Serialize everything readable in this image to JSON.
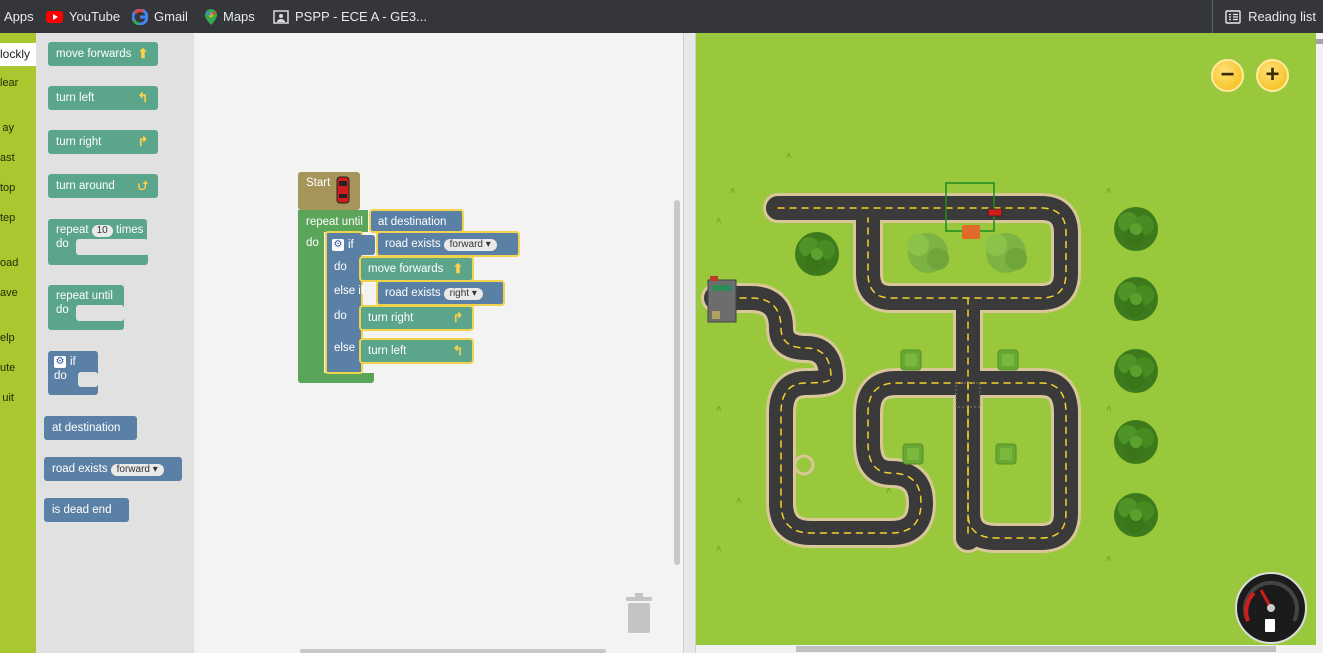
{
  "bookmarks": {
    "items": [
      {
        "label": "Apps",
        "icon": "apps-icon"
      },
      {
        "label": "YouTube",
        "icon": "youtube-icon"
      },
      {
        "label": "Gmail",
        "icon": "google-icon"
      },
      {
        "label": "Maps",
        "icon": "maps-icon"
      },
      {
        "label": "PSPP - ECE A - GE3...",
        "icon": "classroom-icon"
      }
    ],
    "reading_list": "Reading list"
  },
  "sidebar": {
    "active_tab": "lockly",
    "items": [
      "lear",
      "ay",
      "ast",
      "top",
      "tep",
      "oad",
      "ave",
      "elp",
      "ute",
      "uit"
    ]
  },
  "toolbox": {
    "move_forwards": "move forwards",
    "turn_left": "turn left",
    "turn_right": "turn right",
    "turn_around": "turn around",
    "repeat_label": "repeat",
    "repeat_count": "10",
    "times_label": "times",
    "do_label": "do",
    "repeat_until": "repeat until",
    "if_label": "if",
    "at_destination": "at destination",
    "road_exists": "road exists",
    "road_exists_option": "forward",
    "is_dead_end": "is dead end"
  },
  "program": {
    "start": "Start",
    "repeat_until": "repeat until",
    "condition": "at destination",
    "do_label": "do",
    "if_label": "if",
    "if_condition": "road exists",
    "if_option": "forward",
    "if_action": "move forwards",
    "else_if_label": "else if",
    "else_if_condition": "road exists",
    "else_if_option": "right",
    "else_if_action": "turn right",
    "else_label": "else",
    "else_action": "turn left"
  },
  "map": {
    "zoom_out": "−",
    "zoom_in": "+",
    "colors": {
      "grass": "#99c83c",
      "road": "#3a3a3a",
      "road_edge": "#d9c79a",
      "lane": "#f4d12b"
    }
  }
}
